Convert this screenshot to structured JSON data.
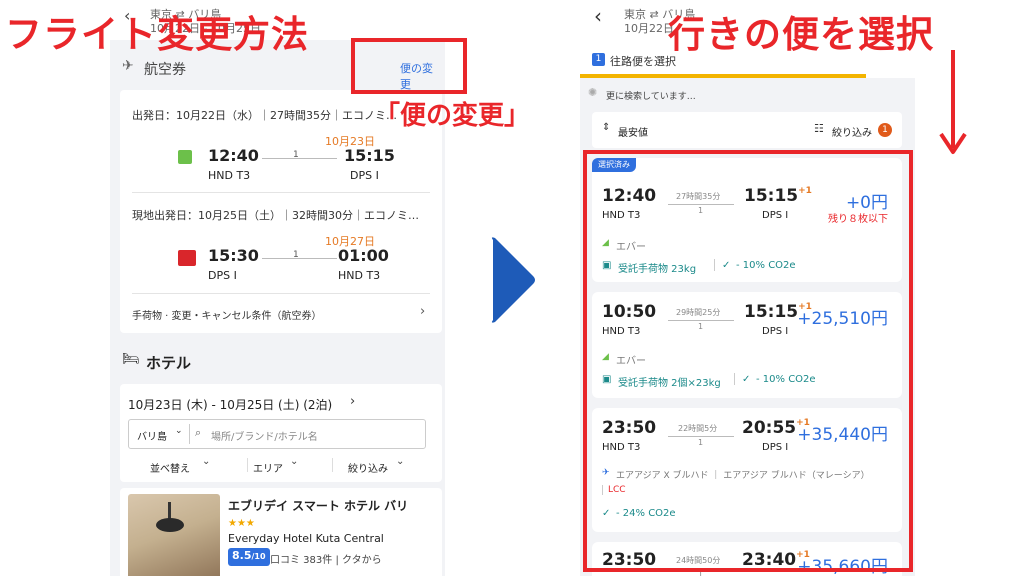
{
  "left": {
    "overlay_title": "フライト変更方法",
    "header_route": "東京 ⇄ バリ島",
    "header_dates": "10月22日 - 10月25日",
    "flight_section_title": "航空券",
    "change_link": "便の変更",
    "change_callout": "「便の変更」",
    "outbound": {
      "info": "出発日：10月22日（水）｜27時間35分｜エコノミ…",
      "arrival_date": "10月23日",
      "dep_time": "12:40",
      "dep_code": "HND T3",
      "stops": "1",
      "arr_time": "15:15",
      "arr_code": "DPS I"
    },
    "return": {
      "info": "現地出発日：10月25日（土）｜32時間30分｜エコノミ…",
      "arrival_date": "10月27日",
      "dep_time": "15:30",
      "dep_code": "DPS I",
      "stops": "1",
      "arr_time": "01:00",
      "arr_code": "HND T3"
    },
    "baggage_row": "手荷物 · 変更・キャンセル条件（航空券）",
    "hotel_section_title": "ホテル",
    "hotel_dates": "10月23日 (木) - 10月25日 (土) (2泊)",
    "location_select": "バリ島",
    "search_placeholder": "場所/ブランド/ホテル名",
    "sort_label": "並べ替え",
    "area_label": "エリア",
    "filter_label": "絞り込み",
    "hotel": {
      "name": "エブリデイ スマート ホテル バリ",
      "stars": "★★★",
      "name_en": "Everyday Hotel Kuta Central",
      "score": "8.5",
      "score_max": "/10",
      "reviews": "口コミ 383件 | クタから"
    }
  },
  "right": {
    "overlay_title": "行きの便を選択",
    "header_route": "東京 ⇄ バリ島",
    "header_dates": "10月22日",
    "step_number": "1",
    "step_label": "往路便を選択",
    "searching": "更に検索しています…",
    "sort_label": "最安値",
    "filter_label": "絞り込み",
    "filter_count": "1",
    "selected_badge": "選択済み",
    "flights": [
      {
        "dep": "12:40",
        "dep_code": "HND T3",
        "duration": "27時間35分",
        "stops": "1",
        "arr": "15:15",
        "plus": "+1",
        "arr_code": "DPS I",
        "price": "+0円",
        "note": "残り８枚以下",
        "airline": "エバー",
        "baggage": "受託手荷物 23kg",
        "co2": "- 10% CO2e"
      },
      {
        "dep": "10:50",
        "dep_code": "HND T3",
        "duration": "29時間25分",
        "stops": "1",
        "arr": "15:15",
        "plus": "+1",
        "arr_code": "DPS I",
        "price": "+25,510円",
        "note": "",
        "airline": "エバー",
        "baggage": "受託手荷物 2個×23kg",
        "co2": "- 10% CO2e"
      },
      {
        "dep": "23:50",
        "dep_code": "HND T3",
        "duration": "22時間5分",
        "stops": "1",
        "arr": "20:55",
        "plus": "+1",
        "arr_code": "DPS I",
        "price": "+35,440円",
        "note": "",
        "airline": "エアアジア X ブルハド ｜ エアアジア ブルハド（マレーシア）",
        "lcc": "LCC",
        "co2": "- 24% CO2e"
      },
      {
        "dep": "23:50",
        "dep_code": "",
        "duration": "24時間50分",
        "stops": "1",
        "arr": "23:40",
        "plus": "+1",
        "arr_code": "",
        "price": "+35,660円"
      }
    ]
  },
  "colors": {
    "accent_red": "#e9262a",
    "link_blue": "#2f6fde",
    "arrow_blue": "#1e5bb8",
    "orange": "#e57a25",
    "teal": "#1b8a8a"
  }
}
